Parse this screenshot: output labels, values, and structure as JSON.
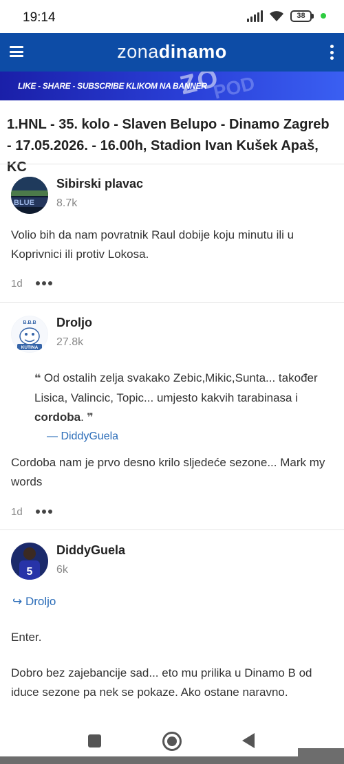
{
  "status_bar": {
    "time": "19:14",
    "battery": "38"
  },
  "header": {
    "logo_part1": "zona",
    "logo_part2": "dinamo"
  },
  "banner": {
    "text": "LIKE - SHARE - SUBSCRIBE KLIKOM NA BANNER",
    "deco1": "ZO",
    "deco2": "POD"
  },
  "topic": {
    "title": "1.HNL - 35. kolo - Slaven Belupo - Dinamo Zagreb - 17.05.2026. - 16.00h, Stadion Ivan Kušek Apaš, KC"
  },
  "posts": [
    {
      "author": "Sibirski plavac",
      "reputation": "8.7k",
      "body": "Volio bih da nam povratnik Raul dobije koju minutu ili u Koprivnici ili protiv Lokosa.",
      "time": "1d"
    },
    {
      "author": "Droljo",
      "reputation": "27.8k",
      "quote_before": "Od ostalih zelja svakako Zebic,Mikic,Sunta... također Lisica, Valincic, Topic... umjesto kakvih tarabinasa i ",
      "quote_bold": "cordoba",
      "quote_after": ".",
      "quote_author": "— DiddyGuela",
      "body": "Cordoba nam je prvo desno krilo sljedeće sezone... Mark my words",
      "time": "1d"
    },
    {
      "author": "DiddyGuela",
      "reputation": "6k",
      "reply_to": "↪ Droljo",
      "body1": "Enter.",
      "body2": "Dobro bez zajebancije sad... eto mu prilika u Dinamo B od iduce sezone pa nek se pokaze. Ako ostane naravno."
    }
  ],
  "avatars": {
    "avatar2_text_top": "B.B.B",
    "avatar2_text_bottom": "KUTINA",
    "avatar3_number": "5"
  },
  "colors": {
    "header_bg": "#0d4ca6",
    "link": "#2a6cb8",
    "banner_bg": "#2a40d8"
  }
}
